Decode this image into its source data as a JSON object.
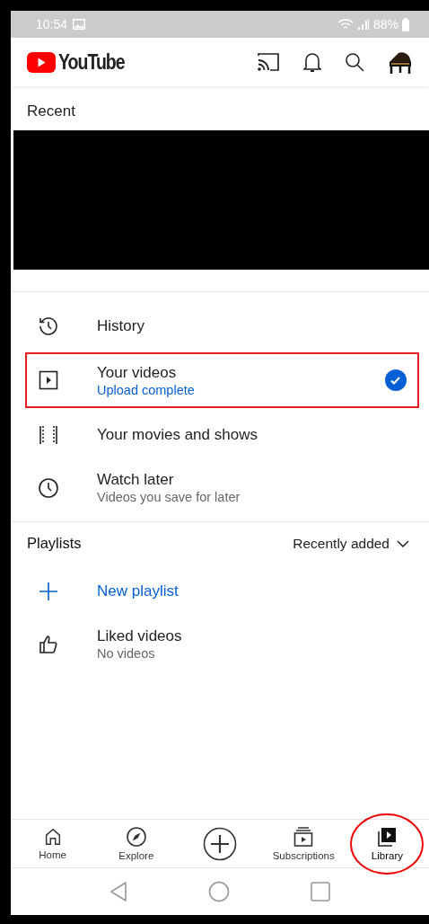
{
  "status_bar": {
    "time": "10:54",
    "battery": "88%"
  },
  "header": {
    "logo": "YouTube"
  },
  "recent": {
    "title": "Recent",
    "redacted": true
  },
  "library_items": [
    {
      "kind": "history",
      "title": "History",
      "highlighted": false,
      "done": false
    },
    {
      "kind": "videos",
      "title": "Your videos",
      "subtitle": "Upload complete",
      "subtitle_accent": true,
      "highlighted": true,
      "done": true
    },
    {
      "kind": "movies",
      "title": "Your movies and shows",
      "highlighted": false,
      "done": false
    },
    {
      "kind": "later",
      "title": "Watch later",
      "subtitle": "Videos you save for later",
      "subtitle_accent": false,
      "highlighted": false,
      "done": false
    }
  ],
  "playlists": {
    "title": "Playlists",
    "sort": "Recently added",
    "items": [
      {
        "kind": "new",
        "title": "New playlist"
      },
      {
        "kind": "liked",
        "title": "Liked videos",
        "subtitle": "No videos"
      }
    ]
  },
  "bottom_nav": [
    {
      "kind": "home",
      "label": "Home",
      "selected": false,
      "circled": false
    },
    {
      "kind": "explore",
      "label": "Explore",
      "selected": false,
      "circled": false
    },
    {
      "kind": "create",
      "selected": false,
      "circled": false
    },
    {
      "kind": "subscriptions",
      "label": "Subscriptions",
      "selected": false,
      "circled": false
    },
    {
      "kind": "library",
      "label": "Library",
      "selected": true,
      "circled": true
    }
  ]
}
